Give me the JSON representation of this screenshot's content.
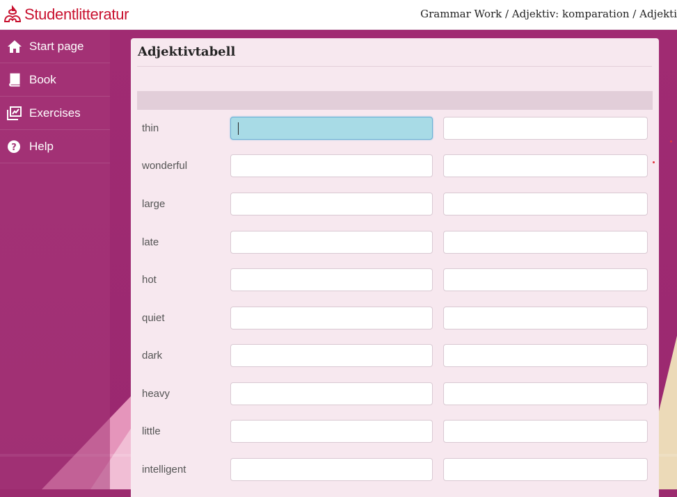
{
  "brand": {
    "name": "Studentlitteratur",
    "color": "#c8102e"
  },
  "breadcrumb": "Grammar Work / Adjektiv: komparation / Adjekti",
  "sidebar": {
    "items": [
      {
        "label": "Start page",
        "icon": "home-icon"
      },
      {
        "label": "Book",
        "icon": "book-icon"
      },
      {
        "label": "Exercises",
        "icon": "exercises-icon"
      },
      {
        "label": "Help",
        "icon": "help-icon"
      }
    ]
  },
  "exercise": {
    "title": "Adjektivtabell",
    "rows": [
      {
        "word": "thin",
        "col1": "",
        "col2": "",
        "active": true
      },
      {
        "word": "wonderful",
        "col1": "",
        "col2": ""
      },
      {
        "word": "large",
        "col1": "",
        "col2": ""
      },
      {
        "word": "late",
        "col1": "",
        "col2": ""
      },
      {
        "word": "hot",
        "col1": "",
        "col2": ""
      },
      {
        "word": "quiet",
        "col1": "",
        "col2": ""
      },
      {
        "word": "dark",
        "col1": "",
        "col2": ""
      },
      {
        "word": "heavy",
        "col1": "",
        "col2": ""
      },
      {
        "word": "little",
        "col1": "",
        "col2": ""
      },
      {
        "word": "intelligent",
        "col1": "",
        "col2": ""
      }
    ]
  },
  "colors": {
    "background": "#9b2a6e",
    "panel": "#f7e8ef",
    "active_input": "#a8dbe6"
  }
}
